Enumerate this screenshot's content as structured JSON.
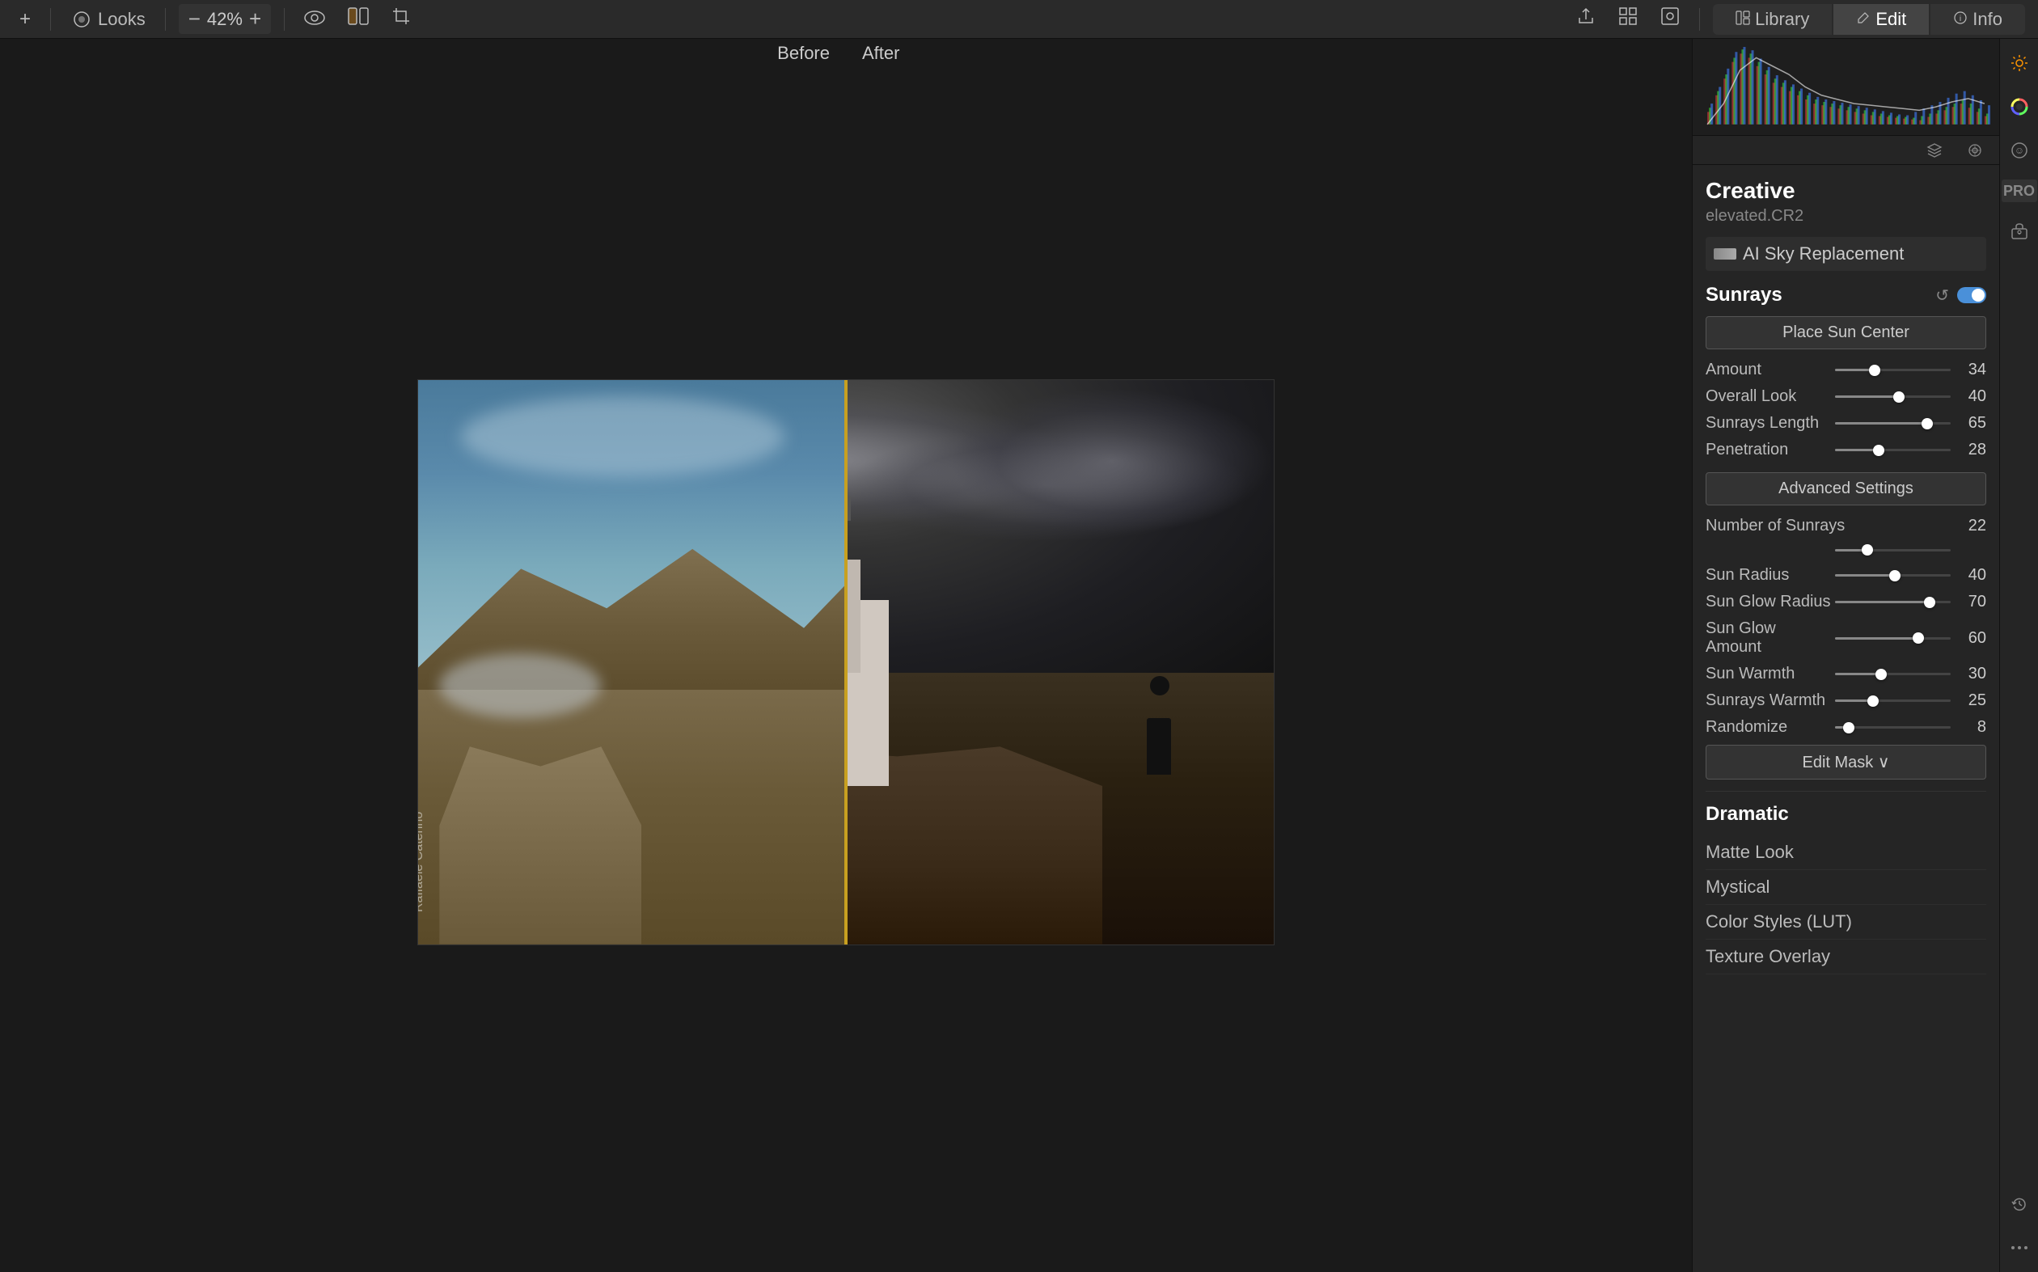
{
  "toolbar": {
    "add_label": "+",
    "looks_label": "Looks",
    "zoom_value": "42%",
    "zoom_minus": "−",
    "zoom_plus": "+",
    "before_label": "Before",
    "after_label": "After",
    "watermark": "Raffaele Caterino"
  },
  "top_nav": {
    "library_label": "Library",
    "edit_label": "Edit",
    "info_label": "Info"
  },
  "panel": {
    "title": "Creative",
    "subtitle": "elevated.CR2",
    "ai_sky_label": "AI Sky Replacement"
  },
  "sunrays": {
    "section_title": "Sunrays",
    "place_sun_btn": "Place Sun Center",
    "advanced_settings_btn": "Advanced Settings",
    "edit_mask_btn": "Edit Mask ∨",
    "sliders": [
      {
        "label": "Amount",
        "value": 34,
        "pct": 34
      },
      {
        "label": "Overall Look",
        "value": 40,
        "pct": 55
      },
      {
        "label": "Sunrays Length",
        "value": 65,
        "pct": 80
      },
      {
        "label": "Penetration",
        "value": 28,
        "pct": 38
      }
    ],
    "number_of_sunrays": {
      "label": "Number of Sunrays",
      "value": 22,
      "pct": 28
    },
    "extra_sliders": [
      {
        "label": "Sun Radius",
        "value": 40,
        "pct": 52
      },
      {
        "label": "Sun Glow Radius",
        "value": 70,
        "pct": 82
      },
      {
        "label": "Sun Glow Amount",
        "value": 60,
        "pct": 72
      },
      {
        "label": "Sun Warmth",
        "value": 30,
        "pct": 40
      },
      {
        "label": "Sunrays Warmth",
        "value": 25,
        "pct": 33
      },
      {
        "label": "Randomize",
        "value": 8,
        "pct": 12
      }
    ]
  },
  "dramatic": {
    "section_title": "Dramatic",
    "items": [
      {
        "label": "Matte Look"
      },
      {
        "label": "Mystical"
      },
      {
        "label": "Color Styles (LUT)"
      },
      {
        "label": "Texture Overlay"
      }
    ]
  }
}
